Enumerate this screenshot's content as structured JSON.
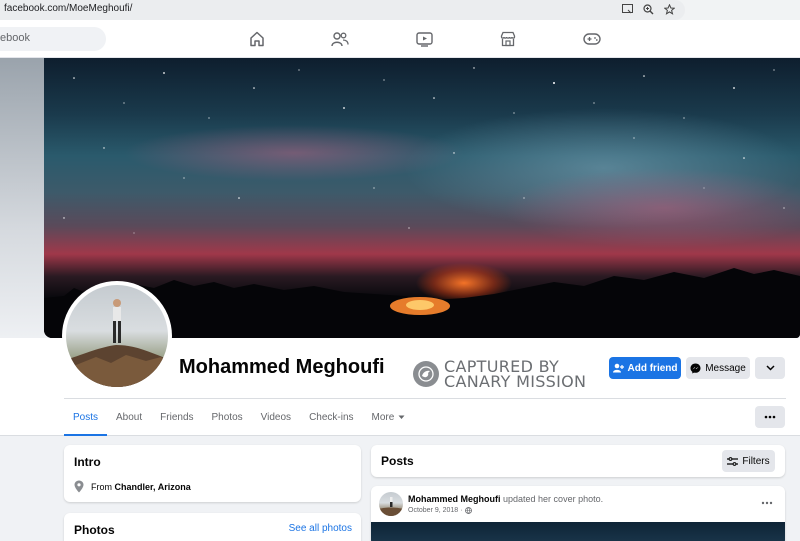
{
  "browser": {
    "url": "facebook.com/MoeMeghoufi/",
    "icons": [
      "cast-icon",
      "zoom-icon",
      "bookmark-star-icon"
    ]
  },
  "topnav": {
    "search_text": "ebook",
    "icons": [
      "home-icon",
      "friends-icon",
      "watch-icon",
      "marketplace-icon",
      "gaming-icon"
    ]
  },
  "profile": {
    "name": "Mohammed Meghoufi",
    "stamp_line1": "CAPTURED BY",
    "stamp_line2": "CANARY MISSION",
    "add_friend_label": "Add friend",
    "message_label": "Message"
  },
  "tabs": [
    {
      "label": "Posts",
      "active": true
    },
    {
      "label": "About"
    },
    {
      "label": "Friends"
    },
    {
      "label": "Photos"
    },
    {
      "label": "Videos"
    },
    {
      "label": "Check-ins"
    },
    {
      "label": "More"
    }
  ],
  "intro": {
    "title": "Intro",
    "from_prefix": "From",
    "from_place": "Chandler, Arizona"
  },
  "photos": {
    "title": "Photos",
    "see_all": "See all photos"
  },
  "posts": {
    "title": "Posts",
    "filters_label": "Filters",
    "item": {
      "author": "Mohammed Meghoufi",
      "action": "updated her cover photo.",
      "date": "October 9, 2018",
      "date_suffix": "·"
    }
  },
  "colors": {
    "accent": "#1b74e4",
    "page_bg": "#f0f2f5",
    "button_gray": "#e4e6eb"
  }
}
